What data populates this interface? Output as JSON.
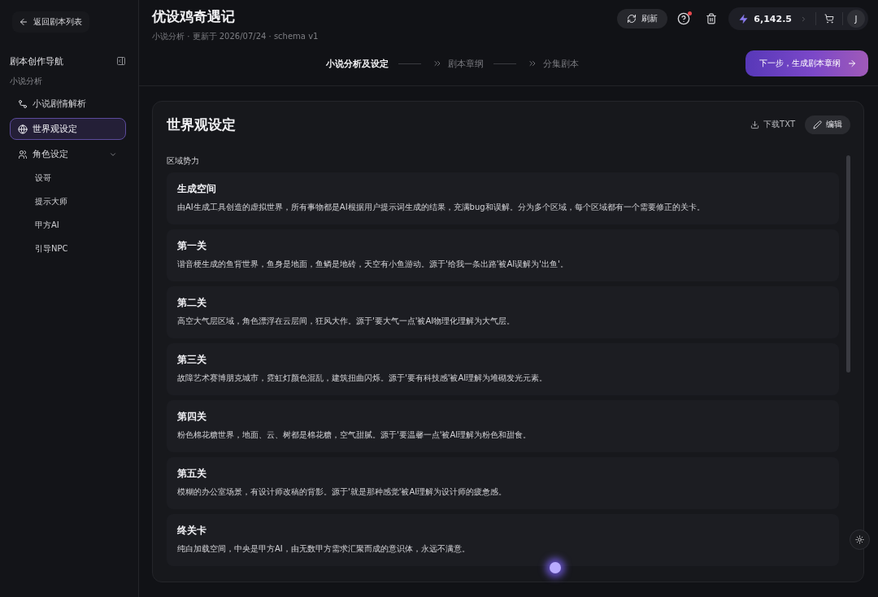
{
  "sidebar": {
    "back_button": "返回剧本列表",
    "title": "剧本创作导航",
    "groups": [
      {
        "label": "小说分析",
        "items": [
          {
            "label": "小说剧情解析",
            "selected": false
          },
          {
            "label": "世界观设定",
            "selected": true
          },
          {
            "label": "角色设定",
            "selected": false,
            "expanded": true,
            "children": [
              {
                "label": "设哥",
                "selected": false
              },
              {
                "label": "提示大师",
                "selected": false
              },
              {
                "label": "甲方AI",
                "selected": false
              },
              {
                "label": "引导NPC",
                "selected": false
              }
            ]
          }
        ]
      }
    ]
  },
  "header": {
    "title": "优设鸡奇遇记",
    "subtitle": "小说分析 · 更新于 2026/07/24 · schema v1",
    "refresh_button": "刷新",
    "help_button": {
      "notification": true
    },
    "credits": "6,142.5",
    "avatar": "J"
  },
  "steps": [
    {
      "label": "小说分析及设定",
      "selected": true
    },
    {
      "label": "剧本章纲",
      "selected": false
    },
    {
      "label": "分集剧本",
      "selected": false
    }
  ],
  "next_button": "下一步，生成剧本章纲",
  "panel": {
    "title": "世界观设定",
    "download_button": "下载TXT",
    "edit_button": "编辑",
    "section": "区域势力",
    "entries": [
      {
        "title": "生成空间",
        "description": "由AI生成工具创造的虚拟世界，所有事物都是AI根据用户提示词生成的结果，充满bug和误解。分为多个区域，每个区域都有一个需要修正的关卡。"
      },
      {
        "title": "第一关",
        "description": "谐音梗生成的鱼背世界，鱼身是地面，鱼鳞是地砖，天空有小鱼游动。源于'给我一条出路'被AI误解为'出鱼'。"
      },
      {
        "title": "第二关",
        "description": "高空大气层区域，角色漂浮在云层间，狂风大作。源于'要大气一点'被AI物理化理解为大气层。"
      },
      {
        "title": "第三关",
        "description": "故障艺术赛博朋克城市，霓虹灯颜色混乱，建筑扭曲闪烁。源于'要有科技感'被AI理解为堆砌发光元素。"
      },
      {
        "title": "第四关",
        "description": "粉色棉花糖世界，地面、云、树都是棉花糖，空气甜腻。源于'要温馨一点'被AI理解为粉色和甜食。"
      },
      {
        "title": "第五关",
        "description": "模糊的办公室场景，有设计师改稿的背影。源于'就是那种感觉'被AI理解为设计师的疲惫感。"
      },
      {
        "title": "终关卡",
        "description": "纯白加载空间，中央是甲方AI，由无数甲方需求汇聚而成的意识体，永远不满意。"
      }
    ]
  }
}
